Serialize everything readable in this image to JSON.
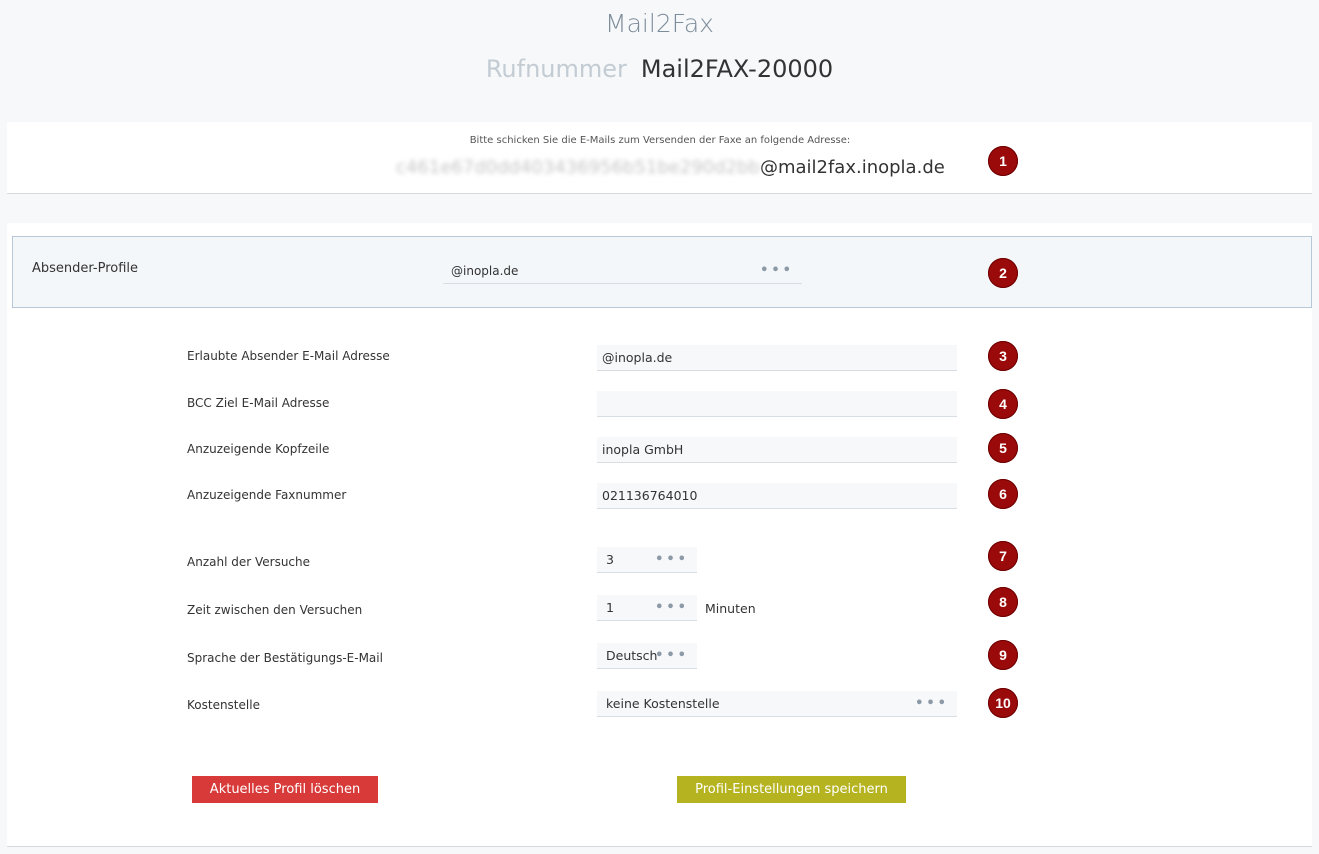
{
  "header": {
    "title": "Mail2Fax",
    "number_label": "Rufnummer",
    "number_value": "Mail2FAX-20000"
  },
  "address": {
    "hint": "Bitte schicken Sie die E-Mails zum Versenden der Faxe an folgende Adresse:",
    "blurred_part": "c461e67d0dd403436956b51be290d2bb",
    "domain": "@mail2fax.inopla.de",
    "badge": "1"
  },
  "profile": {
    "label": "Absender-Profile",
    "selected": "@inopla.de",
    "badge": "2"
  },
  "fields": [
    {
      "label": "Erlaubte Absender E-Mail Adresse",
      "value": "@inopla.de",
      "badge": "3"
    },
    {
      "label": "BCC Ziel E-Mail Adresse",
      "value": "",
      "badge": "4"
    },
    {
      "label": "Anzuzeigende Kopfzeile",
      "value": "inopla GmbH",
      "badge": "5"
    },
    {
      "label": "Anzuzeigende Faxnummer",
      "value": "021136764010",
      "badge": "6"
    },
    {
      "label": "Anzahl der Versuche",
      "value": "3",
      "badge": "7"
    },
    {
      "label": "Zeit zwischen den Versuchen",
      "value": "1",
      "unit": "Minuten",
      "badge": "8"
    },
    {
      "label": "Sprache der Bestätigungs-E-Mail",
      "value": "Deutsch",
      "badge": "9"
    },
    {
      "label": "Kostenstelle",
      "value": "keine Kostenstelle",
      "badge": "10"
    }
  ],
  "dots": "•••",
  "buttons": {
    "delete": "Aktuelles Profil löschen",
    "save": "Profil-Einstellungen speichern"
  },
  "colors": {
    "badge": "#9b0a0a",
    "delete_button": "#d83a3a",
    "save_button": "#b5b320"
  }
}
